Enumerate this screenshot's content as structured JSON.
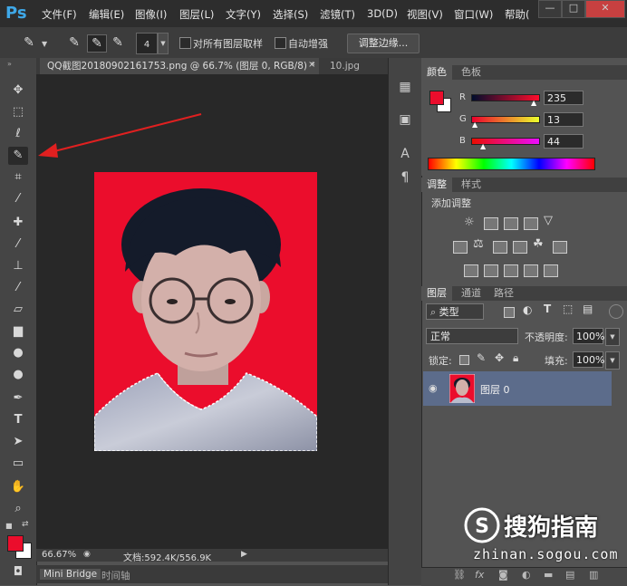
{
  "app": {
    "logo": "Ps"
  },
  "menu": [
    "文件(F)",
    "编辑(E)",
    "图像(I)",
    "图层(L)",
    "文字(Y)",
    "选择(S)",
    "滤镜(T)",
    "3D(D)",
    "视图(V)",
    "窗口(W)",
    "帮助("
  ],
  "window_controls": {
    "minimize": "—",
    "maximize": "□",
    "close": "✕"
  },
  "options": {
    "brush_size": "4",
    "sample_all_label": "对所有图层取样",
    "auto_enhance_label": "自动增强",
    "refine_edge_label": "调整边缘..."
  },
  "document": {
    "tab_title": "QQ截图20180902161753.png @ 66.7% (图层 0, RGB/8) *",
    "second_tab": "10.jpg",
    "zoom": "66.67%",
    "doc_info": "文档:592.4K/556.9K"
  },
  "bottom_tabs": [
    "Mini Bridge",
    "时间轴"
  ],
  "color_panel": {
    "tabs": [
      "颜色",
      "色板"
    ],
    "channels": [
      {
        "label": "R",
        "value": "235"
      },
      {
        "label": "G",
        "value": "13"
      },
      {
        "label": "B",
        "value": "44"
      }
    ],
    "foreground": "#eb0d2c"
  },
  "adjust_panel": {
    "tabs": [
      "调整",
      "样式"
    ],
    "heading": "添加调整"
  },
  "layers_panel": {
    "tabs": [
      "图层",
      "通道",
      "路径"
    ],
    "filter_label": "类型",
    "blend_mode": "正常",
    "opacity_label": "不透明度:",
    "opacity_value": "100%",
    "lock_label": "锁定:",
    "fill_label": "填充:",
    "fill_value": "100%",
    "layer_name": "图层 0"
  },
  "watermark": {
    "brand": "搜狗指南",
    "url": "zhinan.sogou.com"
  }
}
